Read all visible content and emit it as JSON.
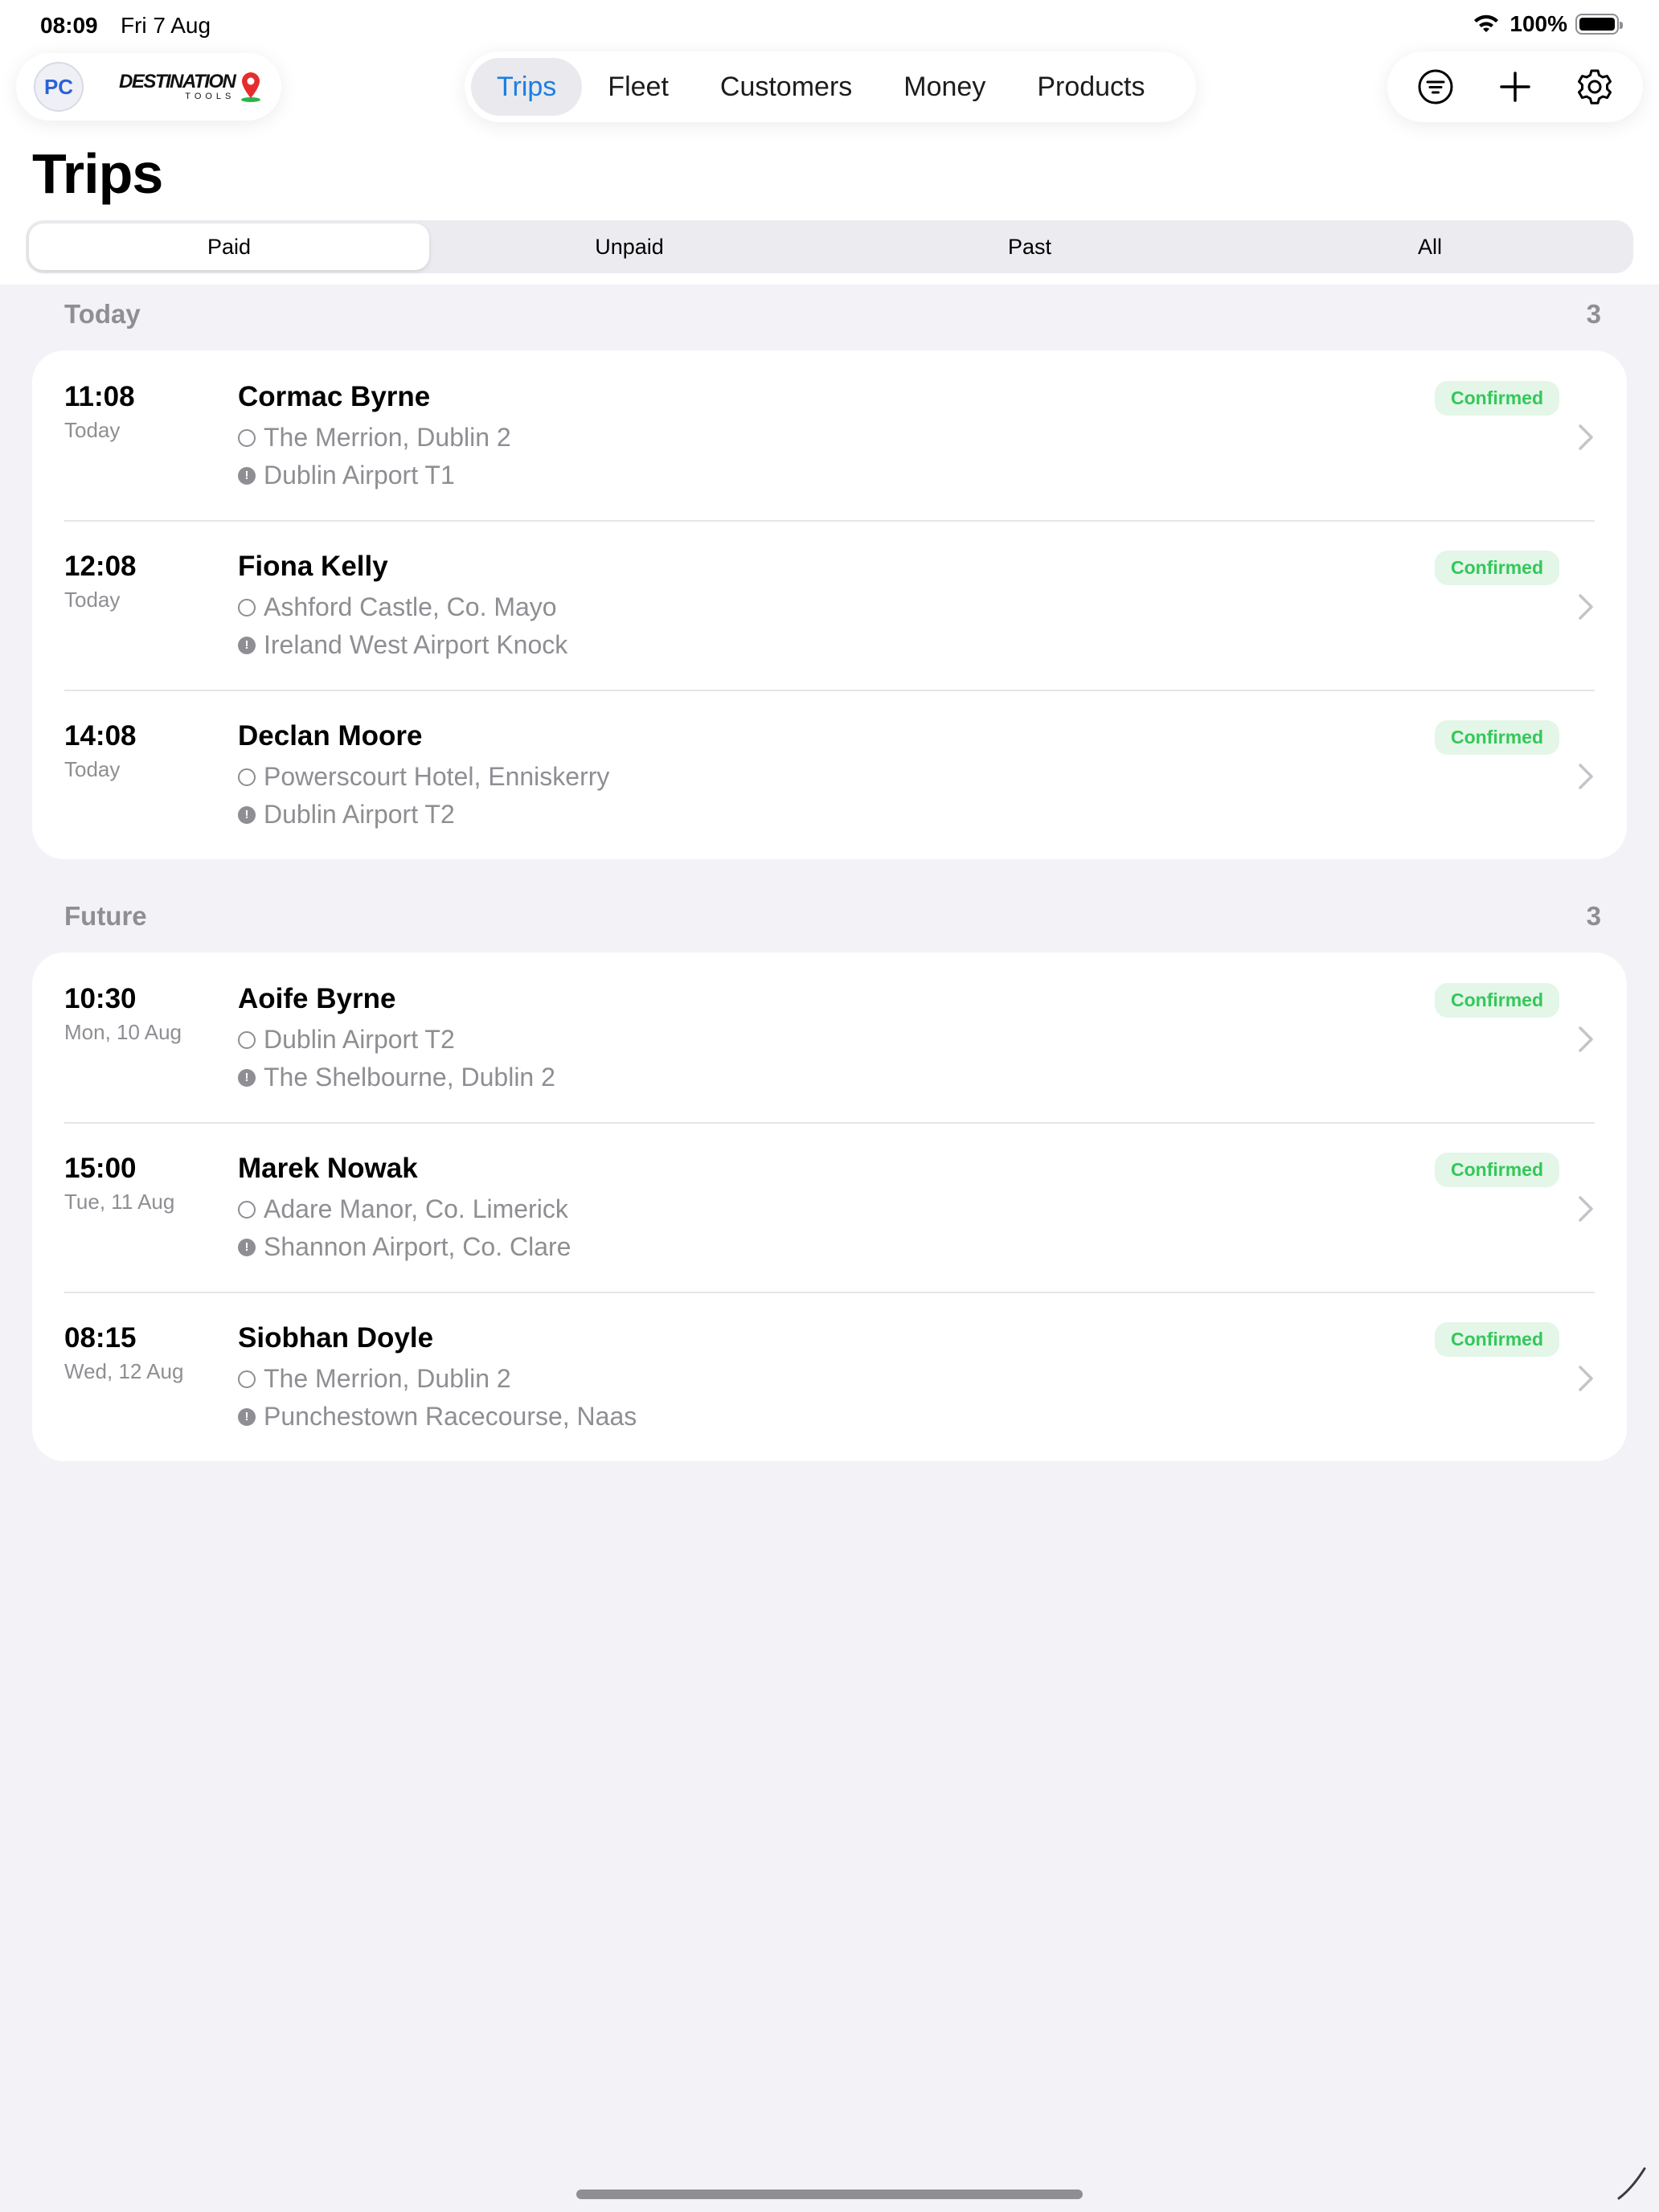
{
  "status_bar": {
    "time": "08:09",
    "date": "Fri 7 Aug",
    "battery": "100%"
  },
  "brand": {
    "avatar_initials": "PC",
    "logo_main": "DESTINATION",
    "logo_sub": "TOOLS"
  },
  "nav": {
    "tabs": [
      {
        "label": "Trips",
        "active": true
      },
      {
        "label": "Fleet",
        "active": false
      },
      {
        "label": "Customers",
        "active": false
      },
      {
        "label": "Money",
        "active": false
      },
      {
        "label": "Products",
        "active": false
      }
    ]
  },
  "actions": {
    "icons": [
      "filter-icon",
      "plus-icon",
      "gear-icon"
    ]
  },
  "page": {
    "title": "Trips"
  },
  "segments": [
    {
      "label": "Paid",
      "active": true
    },
    {
      "label": "Unpaid",
      "active": false
    },
    {
      "label": "Past",
      "active": false
    },
    {
      "label": "All",
      "active": false
    }
  ],
  "sections": [
    {
      "title": "Today",
      "count": "3",
      "trips": [
        {
          "time": "11:08",
          "date": "Today",
          "name": "Cormac Byrne",
          "from": "The Merrion, Dublin 2",
          "to": "Dublin Airport T1",
          "status": "Confirmed"
        },
        {
          "time": "12:08",
          "date": "Today",
          "name": "Fiona Kelly",
          "from": "Ashford Castle, Co. Mayo",
          "to": "Ireland West Airport Knock",
          "status": "Confirmed"
        },
        {
          "time": "14:08",
          "date": "Today",
          "name": "Declan Moore",
          "from": "Powerscourt Hotel, Enniskerry",
          "to": "Dublin Airport T2",
          "status": "Confirmed"
        }
      ]
    },
    {
      "title": "Future",
      "count": "3",
      "trips": [
        {
          "time": "10:30",
          "date": "Mon, 10 Aug",
          "name": "Aoife Byrne",
          "from": "Dublin Airport T2",
          "to": "The Shelbourne, Dublin 2",
          "status": "Confirmed"
        },
        {
          "time": "15:00",
          "date": "Tue, 11 Aug",
          "name": "Marek Nowak",
          "from": "Adare Manor, Co. Limerick",
          "to": "Shannon Airport, Co. Clare",
          "status": "Confirmed"
        },
        {
          "time": "08:15",
          "date": "Wed, 12 Aug",
          "name": "Siobhan Doyle",
          "from": "The Merrion, Dublin 2",
          "to": "Punchestown Racecourse, Naas",
          "status": "Confirmed"
        }
      ]
    }
  ],
  "colors": {
    "accent": "#1a7fe0",
    "confirmed_text": "#34c759",
    "confirmed_bg": "#e3f6e8",
    "background": "#f2f2f7"
  }
}
